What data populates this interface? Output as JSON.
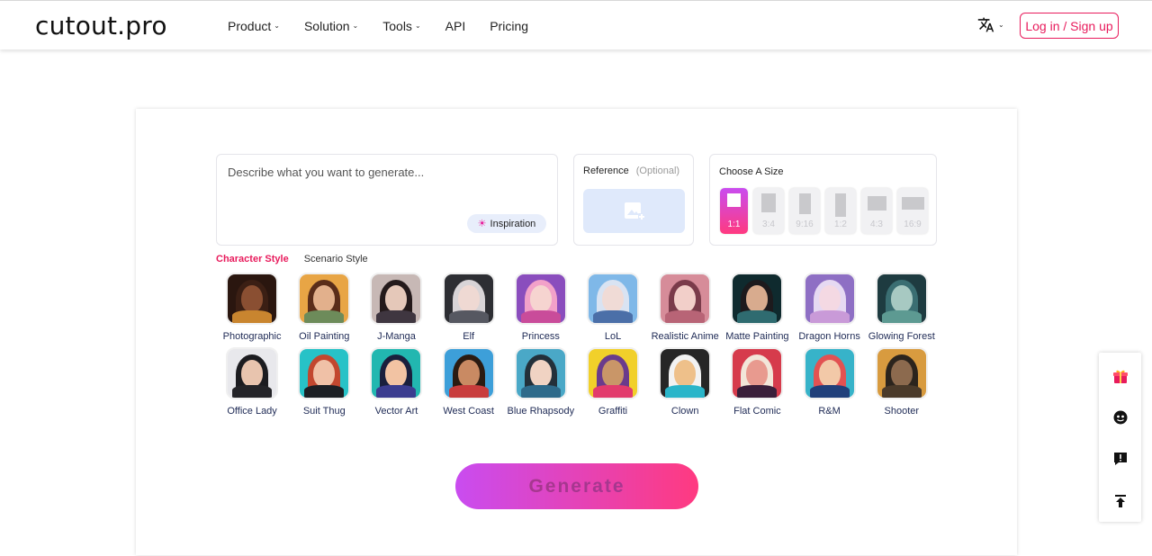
{
  "header": {
    "logo": "cutout.pro",
    "nav": [
      {
        "label": "Product",
        "dropdown": true
      },
      {
        "label": "Solution",
        "dropdown": true
      },
      {
        "label": "Tools",
        "dropdown": true
      },
      {
        "label": "API",
        "dropdown": false
      },
      {
        "label": "Pricing",
        "dropdown": false
      }
    ],
    "login_label": "Log in / Sign up"
  },
  "prompt": {
    "placeholder": "Describe what you want to generate...",
    "value": "",
    "inspiration_label": "Inspiration"
  },
  "reference": {
    "title": "Reference",
    "optional": "(Optional)"
  },
  "size": {
    "title": "Choose A Size",
    "options": [
      "1:1",
      "3:4",
      "9:16",
      "1:2",
      "4:3",
      "16:9"
    ],
    "selected": "1:1"
  },
  "style_tabs": {
    "character": "Character Style",
    "scenario": "Scenario Style",
    "active": "Character Style"
  },
  "styles_row1": [
    "Photographic",
    "Oil Painting",
    "J-Manga",
    "Elf",
    "Princess",
    "LoL",
    "Realistic Anime",
    "Matte Painting",
    "Dragon Horns",
    "Glowing Forest"
  ],
  "styles_row2": [
    "Office Lady",
    "Suit Thug",
    "Vector Art",
    "West Coast",
    "Blue Rhapsody",
    "Graffiti",
    "Clown",
    "Flat Comic",
    "R&M",
    "Shooter"
  ],
  "generate_label": "Generate",
  "side_widget": [
    "gift-icon",
    "feedback-face-icon",
    "report-icon",
    "back-to-top-icon"
  ],
  "colors": {
    "accent": "#e81b5c",
    "gradient_start": "#c94cf0",
    "gradient_end": "#ff3a80"
  }
}
